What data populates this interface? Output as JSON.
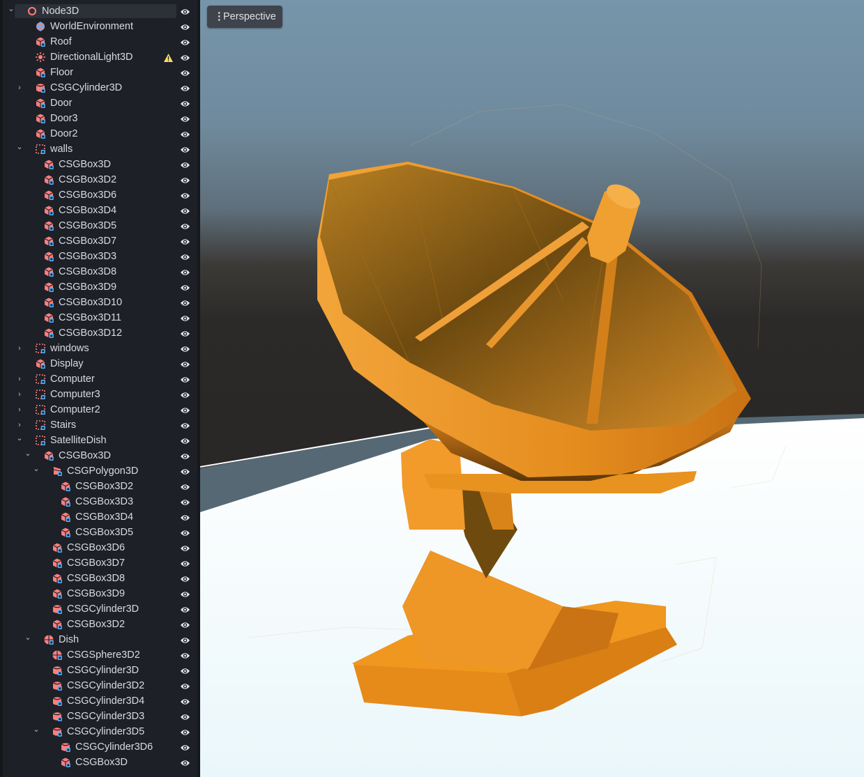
{
  "viewport": {
    "menu_label": "Perspective"
  },
  "tree": [
    {
      "label": "Node3D",
      "depth": 0,
      "icon": "node3d-icon",
      "arrow": "expanded",
      "selected": true
    },
    {
      "label": "WorldEnvironment",
      "depth": 1,
      "icon": "world-environment-icon",
      "arrow": "none"
    },
    {
      "label": "Roof",
      "depth": 1,
      "icon": "csg-box-icon",
      "arrow": "none"
    },
    {
      "label": "DirectionalLight3D",
      "depth": 1,
      "icon": "directional-light-icon",
      "arrow": "none",
      "warning": true
    },
    {
      "label": "Floor",
      "depth": 1,
      "icon": "csg-box-icon",
      "arrow": "none"
    },
    {
      "label": "CSGCylinder3D",
      "depth": 1,
      "icon": "csg-cylinder-icon",
      "arrow": "collapsed"
    },
    {
      "label": "Door",
      "depth": 1,
      "icon": "csg-box-icon",
      "arrow": "none"
    },
    {
      "label": "Door3",
      "depth": 1,
      "icon": "csg-box-icon",
      "arrow": "none"
    },
    {
      "label": "Door2",
      "depth": 1,
      "icon": "csg-box-icon",
      "arrow": "none"
    },
    {
      "label": "walls",
      "depth": 1,
      "icon": "csg-combiner-icon",
      "arrow": "expanded"
    },
    {
      "label": "CSGBox3D",
      "depth": 2,
      "icon": "csg-box-icon",
      "arrow": "none"
    },
    {
      "label": "CSGBox3D2",
      "depth": 2,
      "icon": "csg-box-icon",
      "arrow": "none"
    },
    {
      "label": "CSGBox3D6",
      "depth": 2,
      "icon": "csg-box-icon",
      "arrow": "none"
    },
    {
      "label": "CSGBox3D4",
      "depth": 2,
      "icon": "csg-box-icon",
      "arrow": "none"
    },
    {
      "label": "CSGBox3D5",
      "depth": 2,
      "icon": "csg-box-icon",
      "arrow": "none"
    },
    {
      "label": "CSGBox3D7",
      "depth": 2,
      "icon": "csg-box-icon",
      "arrow": "none"
    },
    {
      "label": "CSGBox3D3",
      "depth": 2,
      "icon": "csg-box-icon",
      "arrow": "none"
    },
    {
      "label": "CSGBox3D8",
      "depth": 2,
      "icon": "csg-box-icon",
      "arrow": "none"
    },
    {
      "label": "CSGBox3D9",
      "depth": 2,
      "icon": "csg-box-icon",
      "arrow": "none"
    },
    {
      "label": "CSGBox3D10",
      "depth": 2,
      "icon": "csg-box-icon",
      "arrow": "none"
    },
    {
      "label": "CSGBox3D11",
      "depth": 2,
      "icon": "csg-box-icon",
      "arrow": "none"
    },
    {
      "label": "CSGBox3D12",
      "depth": 2,
      "icon": "csg-box-icon",
      "arrow": "none"
    },
    {
      "label": "windows",
      "depth": 1,
      "icon": "csg-combiner-icon",
      "arrow": "collapsed"
    },
    {
      "label": "Display",
      "depth": 1,
      "icon": "csg-box-icon",
      "arrow": "none"
    },
    {
      "label": "Computer",
      "depth": 1,
      "icon": "csg-combiner-icon",
      "arrow": "collapsed"
    },
    {
      "label": "Computer3",
      "depth": 1,
      "icon": "csg-combiner-icon",
      "arrow": "collapsed"
    },
    {
      "label": "Computer2",
      "depth": 1,
      "icon": "csg-combiner-icon",
      "arrow": "collapsed"
    },
    {
      "label": "Stairs",
      "depth": 1,
      "icon": "csg-combiner-icon",
      "arrow": "collapsed"
    },
    {
      "label": "SatelliteDish",
      "depth": 1,
      "icon": "csg-combiner-icon",
      "arrow": "expanded"
    },
    {
      "label": "CSGBox3D",
      "depth": 2,
      "icon": "csg-box-icon",
      "arrow": "expanded"
    },
    {
      "label": "CSGPolygon3D",
      "depth": 3,
      "icon": "csg-polygon-icon",
      "arrow": "expanded"
    },
    {
      "label": "CSGBox3D2",
      "depth": 4,
      "icon": "csg-box-icon",
      "arrow": "none"
    },
    {
      "label": "CSGBox3D3",
      "depth": 4,
      "icon": "csg-box-icon",
      "arrow": "none"
    },
    {
      "label": "CSGBox3D4",
      "depth": 4,
      "icon": "csg-box-icon",
      "arrow": "none"
    },
    {
      "label": "CSGBox3D5",
      "depth": 4,
      "icon": "csg-box-icon",
      "arrow": "none"
    },
    {
      "label": "CSGBox3D6",
      "depth": 3,
      "icon": "csg-box-icon",
      "arrow": "none"
    },
    {
      "label": "CSGBox3D7",
      "depth": 3,
      "icon": "csg-box-icon",
      "arrow": "none"
    },
    {
      "label": "CSGBox3D8",
      "depth": 3,
      "icon": "csg-box-icon",
      "arrow": "none"
    },
    {
      "label": "CSGBox3D9",
      "depth": 3,
      "icon": "csg-box-icon",
      "arrow": "none"
    },
    {
      "label": "CSGCylinder3D",
      "depth": 3,
      "icon": "csg-cylinder-icon",
      "arrow": "none"
    },
    {
      "label": "CSGBox3D2",
      "depth": 3,
      "icon": "csg-box-icon",
      "arrow": "none"
    },
    {
      "label": "Dish",
      "depth": 2,
      "icon": "csg-sphere-icon",
      "arrow": "expanded"
    },
    {
      "label": "CSGSphere3D2",
      "depth": 3,
      "icon": "csg-sphere-icon",
      "arrow": "none"
    },
    {
      "label": "CSGCylinder3D",
      "depth": 3,
      "icon": "csg-cylinder-icon",
      "arrow": "none"
    },
    {
      "label": "CSGCylinder3D2",
      "depth": 3,
      "icon": "csg-cylinder-icon",
      "arrow": "none"
    },
    {
      "label": "CSGCylinder3D4",
      "depth": 3,
      "icon": "csg-cylinder-icon",
      "arrow": "none"
    },
    {
      "label": "CSGCylinder3D3",
      "depth": 3,
      "icon": "csg-cylinder-icon",
      "arrow": "none"
    },
    {
      "label": "CSGCylinder3D5",
      "depth": 3,
      "icon": "csg-cylinder-icon",
      "arrow": "expanded"
    },
    {
      "label": "CSGCylinder3D6",
      "depth": 4,
      "icon": "csg-cylinder-icon",
      "arrow": "none"
    },
    {
      "label": "CSGBox3D",
      "depth": 4,
      "icon": "csg-box-icon",
      "arrow": "none"
    }
  ],
  "colors": {
    "icon_red": "#fc7f7f",
    "icon_blue": "#57b3ff",
    "warning": "#ffdd65",
    "eye": "#e6e8ea",
    "model_orange": "#f29a2a",
    "floor": "#f4fbfd"
  }
}
